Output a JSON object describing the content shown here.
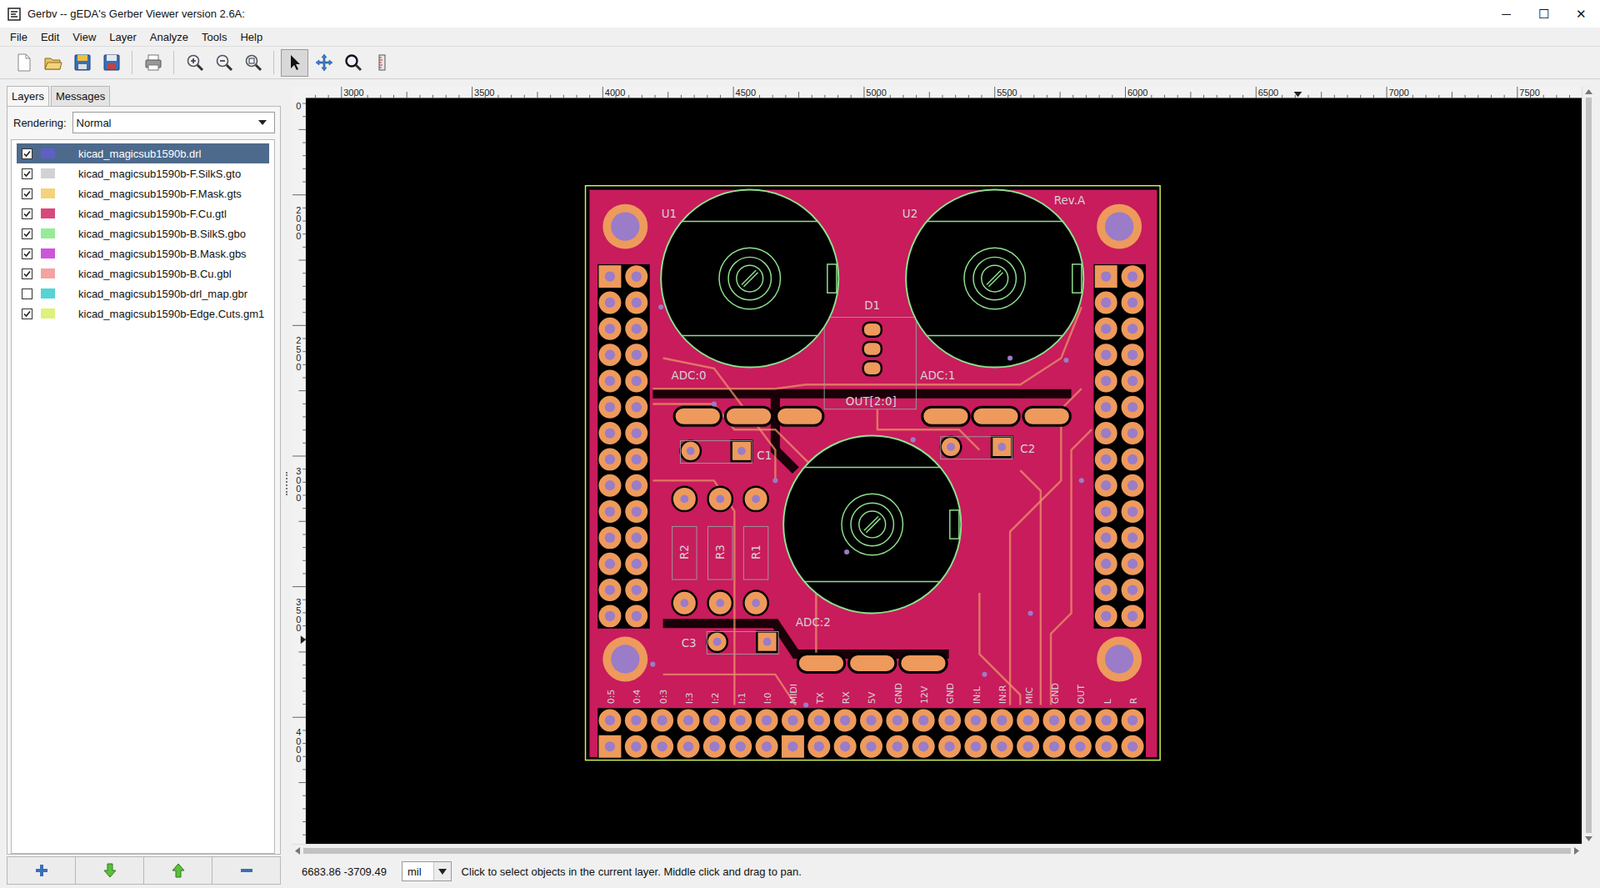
{
  "window": {
    "title": "Gerbv -- gEDA's Gerber Viewer version 2.6A:",
    "controls": [
      "─",
      "☐",
      "✕"
    ]
  },
  "menu": [
    "File",
    "Edit",
    "View",
    "Layer",
    "Analyze",
    "Tools",
    "Help"
  ],
  "toolbar": [
    {
      "selected": false
    },
    {
      "selected": false
    },
    {
      "selected": false
    },
    {
      "selected": false
    },
    {
      "selected": false
    },
    {
      "selected": false
    },
    {
      "selected": false
    },
    {
      "selected": false
    },
    {
      "selected": true
    },
    {
      "selected": false
    },
    {
      "selected": false
    },
    {
      "selected": false
    }
  ],
  "sidebar": {
    "tabs": [
      {
        "label": "Layers",
        "selected": true
      },
      {
        "label": "Messages",
        "selected": false
      }
    ],
    "rendering_label": "Rendering:",
    "rendering_value": "Normal",
    "layers": [
      {
        "name": "kicad_magicsub1590b.drl",
        "visible": true,
        "selected": true,
        "color": "#5f5fc4"
      },
      {
        "name": "kicad_magicsub1590b-F.SilkS.gto",
        "visible": true,
        "selected": false,
        "color": "#d2d2d2"
      },
      {
        "name": "kicad_magicsub1590b-F.Mask.gts",
        "visible": true,
        "selected": false,
        "color": "#f6d27c"
      },
      {
        "name": "kicad_magicsub1590b-F.Cu.gtl",
        "visible": true,
        "selected": false,
        "color": "#d9487c"
      },
      {
        "name": "kicad_magicsub1590b-B.SilkS.gbo",
        "visible": true,
        "selected": false,
        "color": "#96ec96"
      },
      {
        "name": "kicad_magicsub1590b-B.Mask.gbs",
        "visible": true,
        "selected": false,
        "color": "#cc55dc"
      },
      {
        "name": "kicad_magicsub1590b-B.Cu.gbl",
        "visible": true,
        "selected": false,
        "color": "#f4a3a0"
      },
      {
        "name": "kicad_magicsub1590b-drl_map.gbr",
        "visible": false,
        "selected": false,
        "color": "#55d4d4"
      },
      {
        "name": "kicad_magicsub1590b-Edge.Cuts.gm1",
        "visible": true,
        "selected": false,
        "color": "#dcf27a"
      }
    ]
  },
  "rulers": {
    "top": [
      "3000",
      "3500",
      "4000",
      "4500",
      "5000",
      "5500",
      "6000",
      "6500",
      "7000",
      "7500"
    ],
    "left": [
      "0",
      "2000",
      "2500",
      "3000",
      "3500",
      "4000"
    ]
  },
  "board": {
    "silk": [
      "U1",
      "U2",
      "D1",
      "ADC:0",
      "ADC:1",
      "OUT[2:0]",
      "C1",
      "C2",
      "R2",
      "R3",
      "R1",
      "ADC:2",
      "C3",
      "Rev.A"
    ],
    "pin_labels": [
      "0:5",
      "0:4",
      "0:3",
      "I:3",
      "I:2",
      "I:1",
      "I:0",
      "MIDI",
      "TX",
      "RX",
      "5V",
      "GND",
      "12V",
      "GND",
      "IN:L",
      "IN:R",
      "MIC",
      "GND",
      "OUT",
      "L",
      "R"
    ]
  },
  "status_bar": {
    "coords": "6683.86 -3709.49",
    "unit": "mil",
    "message": "Click to select objects in the current layer. Middle click and drag to pan."
  }
}
